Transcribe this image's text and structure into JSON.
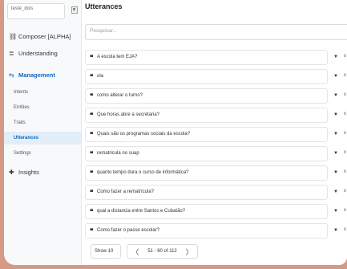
{
  "sidebar": {
    "bot_select": "teste_dois",
    "items": [
      {
        "icon": "⛓",
        "icon_name": "flow-icon",
        "label": "Composer [ALPHA]"
      },
      {
        "icon": "≣",
        "icon_name": "book-icon",
        "label": "Understanding"
      },
      {
        "icon": "⇆",
        "icon_name": "sliders-icon",
        "label": "Management"
      }
    ],
    "management_items": [
      "Intents",
      "Entities",
      "Traits",
      "Utterances",
      "Settings"
    ],
    "insights": {
      "icon": "✚",
      "icon_name": "insights-icon",
      "label": "Insights"
    }
  },
  "main": {
    "title": "Utterances",
    "search_placeholder": "Pesquisar...",
    "utterances": [
      "A escola tem EJA?",
      "ola",
      "como alterar o turno?",
      "Que horas abre a secretaria?",
      "Quais são os programas sociais da escola?",
      "rematricula no suap",
      "quanto tempo dura o curso de informática?",
      "Como fazer a rematrícula?",
      "qual a distancia entre Santos e Cubatão?",
      "Como fazer o passe escolar?"
    ],
    "quote_glyph": "❝",
    "caret_glyph": "▼",
    "close_glyph": "x"
  },
  "pagination": {
    "show_label": "Show 10",
    "range": "51 - 60 of 112",
    "prev": "〈",
    "next": "〉"
  },
  "colors": {
    "accent": "#1565c0",
    "selected_bg": "#e3eefb",
    "backdrop": "#d49a85"
  }
}
